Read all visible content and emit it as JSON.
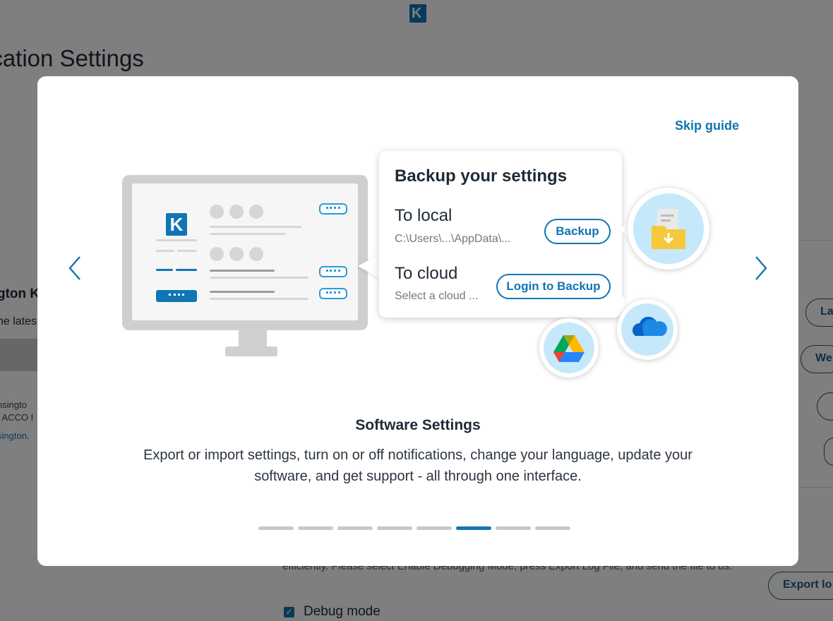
{
  "background": {
    "logo_letter": "K",
    "page_title": "ication Settings",
    "section_heading": "gton K",
    "section_sub": "he lates",
    "footer_line1": "nsingto",
    "footer_line2": "f ACCO I",
    "footer_link": "sington.",
    "pill_labels": [
      "La",
      "We",
      "",
      "",
      "Export lo"
    ],
    "description": "efficiently. Please select Enable Debugging Mode, press Export Log File, and send the file to us.",
    "debug_label": "Debug mode"
  },
  "modal": {
    "skip_label": "Skip guide",
    "prev_icon": "chevron-left-icon",
    "next_icon": "chevron-right-icon",
    "illustration": {
      "monitor_logo": "K",
      "card_title": "Backup your settings",
      "local_label": "To local",
      "local_path": "C:\\Users\\...\\AppData\\...",
      "backup_button": "Backup",
      "cloud_label": "To cloud",
      "cloud_placeholder": "Select a cloud ...",
      "login_button": "Login to Backup"
    },
    "slide_title": "Software Settings",
    "slide_description": "Export or import settings, turn on or off notifications, change your language, update your software, and get support - all through one interface.",
    "pagination": {
      "total": 8,
      "active_index": 5
    }
  },
  "colors": {
    "accent": "#1175b3",
    "overlay": "#808080",
    "bubble_fill": "#c5e8fb"
  }
}
